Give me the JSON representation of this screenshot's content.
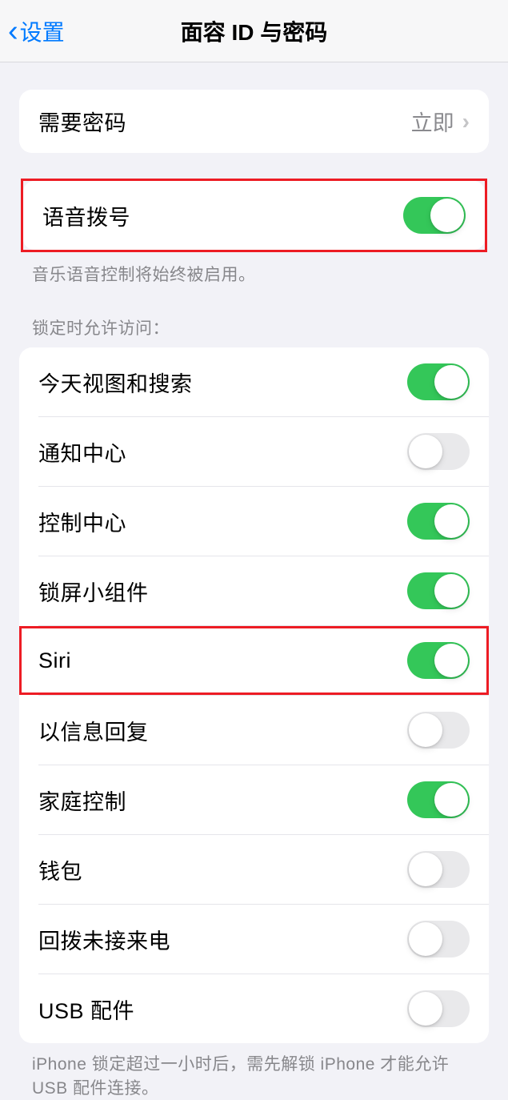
{
  "nav": {
    "back_label": "设置",
    "title": "面容 ID 与密码"
  },
  "require_passcode": {
    "label": "需要密码",
    "value": "立即"
  },
  "voice_dial": {
    "label": "语音拨号",
    "on": true,
    "footer": "音乐语音控制将始终被启用。"
  },
  "lock_access": {
    "header": "锁定时允许访问：",
    "items": [
      {
        "label": "今天视图和搜索",
        "on": true,
        "highlighted": false
      },
      {
        "label": "通知中心",
        "on": false,
        "highlighted": false
      },
      {
        "label": "控制中心",
        "on": true,
        "highlighted": false
      },
      {
        "label": "锁屏小组件",
        "on": true,
        "highlighted": false
      },
      {
        "label": "Siri",
        "on": true,
        "highlighted": true
      },
      {
        "label": "以信息回复",
        "on": false,
        "highlighted": false
      },
      {
        "label": "家庭控制",
        "on": true,
        "highlighted": false
      },
      {
        "label": "钱包",
        "on": false,
        "highlighted": false
      },
      {
        "label": "回拨未接来电",
        "on": false,
        "highlighted": false
      },
      {
        "label": "USB 配件",
        "on": false,
        "highlighted": false
      }
    ],
    "footer": "iPhone 锁定超过一小时后，需先解锁 iPhone 才能允许USB 配件连接。"
  }
}
